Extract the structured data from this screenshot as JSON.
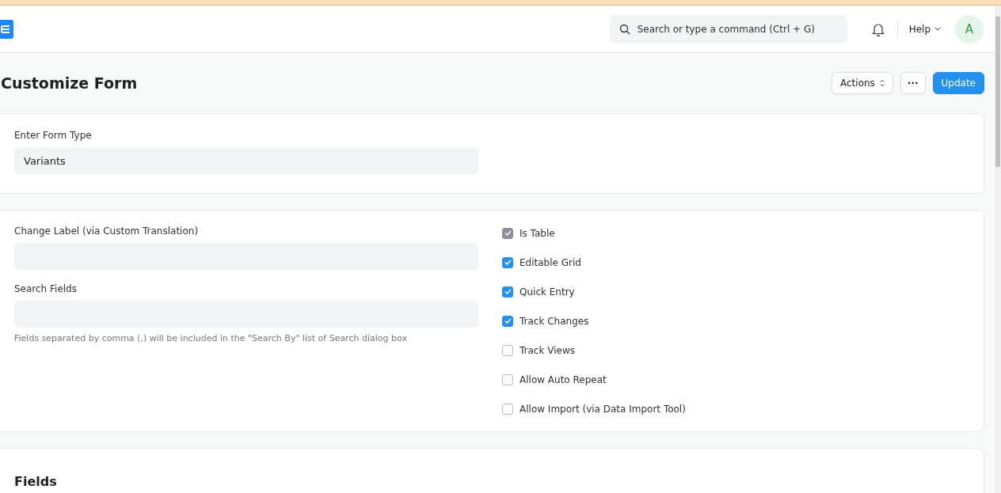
{
  "navbar": {
    "search": {
      "placeholder": "Search or type a command (Ctrl + G)"
    },
    "help": "Help",
    "avatar": "A"
  },
  "page": {
    "title": "Customize Form",
    "actions": [
      {
        "kind": "dropdown",
        "label": "Actions"
      },
      {
        "kind": "more",
        "label": "···"
      },
      {
        "kind": "primary",
        "label": "Update"
      }
    ]
  },
  "form_type": {
    "label": "Enter Form Type",
    "value": "Variants"
  },
  "settings": {
    "fields": [
      {
        "label": "Change Label (via Custom Translation)"
      },
      {
        "label": "Search Fields",
        "help": "Fields separated by comma (,) will be included in the \"Search By\" list of Search dialog box"
      }
    ],
    "checkboxes": [
      {
        "label": "Is Table",
        "checked": true,
        "disabled": true
      },
      {
        "label": "Editable Grid",
        "checked": true,
        "disabled": false
      },
      {
        "label": "Quick Entry",
        "checked": true,
        "disabled": false
      },
      {
        "label": "Track Changes",
        "checked": true,
        "disabled": false
      },
      {
        "label": "Track Views",
        "checked": false,
        "disabled": false
      },
      {
        "label": "Allow Auto Repeat",
        "checked": false,
        "disabled": false
      },
      {
        "label": "Allow Import (via Data Import Tool)",
        "checked": false,
        "disabled": false
      }
    ]
  },
  "fields_section": {
    "title": "Fields"
  }
}
